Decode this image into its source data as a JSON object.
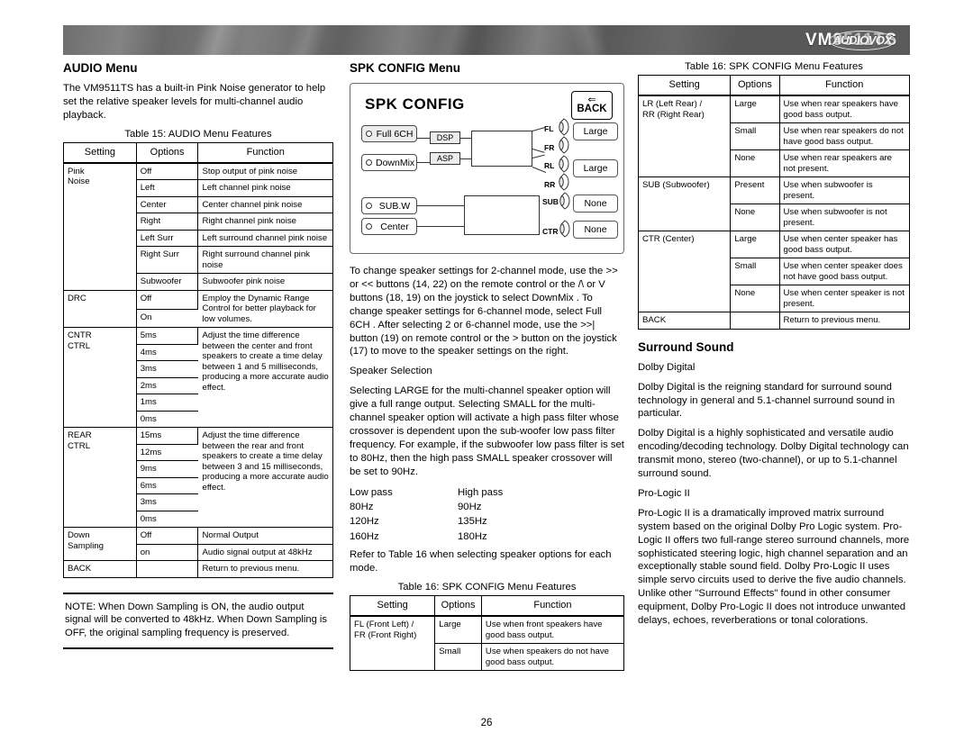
{
  "header": {
    "model": "VM9511TS",
    "logo": "AUDIOVOX"
  },
  "page_number": "26",
  "left_column": {
    "heading": "AUDIO Menu",
    "intro": "The VM9511TS has a built-in Pink Noise generator to help set the relative speaker levels for multi-channel audio playback.",
    "table_caption": "Table 15: AUDIO Menu Features",
    "table": {
      "headers": [
        "Setting",
        "Options",
        "Function"
      ],
      "groups": [
        {
          "setting": "Pink\nNoise",
          "rows": [
            {
              "option": "Off",
              "function": "Stop output of pink noise"
            },
            {
              "option": "Left",
              "function": "Left channel pink noise"
            },
            {
              "option": "Center",
              "function": "Center channel pink noise"
            },
            {
              "option": "Right",
              "function": "Right channel pink noise"
            },
            {
              "option": "Left Surr",
              "function": "Left surround channel pink noise"
            },
            {
              "option": "Right Surr",
              "function": "Right surround channel pink noise"
            },
            {
              "option": "Subwoofer",
              "function": "Subwoofer pink noise"
            }
          ]
        },
        {
          "setting": "DRC",
          "rows": [
            {
              "option": "Off",
              "function": "Employ the Dynamic Range Control for better playback for low volumes."
            },
            {
              "option": "On",
              "function": ""
            }
          ]
        },
        {
          "setting": "CNTR\nCTRL",
          "rows": [
            {
              "option": "5ms",
              "function": "Adjust the time difference between the center and front speakers to create a time delay between 1 and 5 milliseconds, producing a more accurate audio effect."
            },
            {
              "option": "4ms",
              "function": ""
            },
            {
              "option": "3ms",
              "function": ""
            },
            {
              "option": "2ms",
              "function": ""
            },
            {
              "option": "1ms",
              "function": ""
            },
            {
              "option": "0ms",
              "function": ""
            }
          ]
        },
        {
          "setting": "REAR\nCTRL",
          "rows": [
            {
              "option": "15ms",
              "function": "Adjust the time difference between the rear and front speakers to create a time delay between 3 and 15 milliseconds, producing a more accurate audio effect."
            },
            {
              "option": "12ms",
              "function": ""
            },
            {
              "option": "9ms",
              "function": ""
            },
            {
              "option": "6ms",
              "function": ""
            },
            {
              "option": "3ms",
              "function": ""
            },
            {
              "option": "0ms",
              "function": ""
            }
          ]
        },
        {
          "setting": "Down\nSampling",
          "rows": [
            {
              "option": "Off",
              "function": "Normal Output"
            },
            {
              "option": "on",
              "function": "Audio signal output at 48kHz"
            }
          ]
        },
        {
          "setting": "BACK",
          "rows": [
            {
              "option": "",
              "function": "Return to previous menu."
            }
          ]
        }
      ]
    },
    "note": "NOTE: When Down Sampling is ON, the audio output signal will be converted to 48kHz. When Down Sampling is OFF, the original sampling frequency is preserved."
  },
  "center_column": {
    "heading": "SPK CONFIG Menu",
    "screen": {
      "title": "SPK CONFIG",
      "back_label": "BACK",
      "back_arrow": "⇐",
      "modes": [
        {
          "label": "Full 6CH",
          "selected": true
        },
        {
          "label": "DownMix",
          "selected": false
        }
      ],
      "processors": [
        "DSP",
        "ASP"
      ],
      "sources": [
        {
          "label": "SUB.W"
        },
        {
          "label": "Center"
        }
      ],
      "speakers": [
        {
          "tag": "FL"
        },
        {
          "tag": "FR"
        },
        {
          "tag": "RL"
        },
        {
          "tag": "RR"
        },
        {
          "tag": "SUB"
        },
        {
          "tag": "CTR"
        }
      ],
      "sizes": [
        "Large",
        "Large",
        "None",
        "None"
      ]
    },
    "paragraph1": "To change speaker settings for 2-channel mode, use the >> or << buttons (14, 22) on the remote control or the /\\ or V buttons (18, 19) on the joystick to select  DownMix . To change speaker settings for 6-channel mode, select  Full 6CH . After selecting 2 or 6-channel mode, use the >>| button (19) on remote control or the > button on the joystick (17) to move to the speaker settings on the right.",
    "subheading": "Speaker Selection",
    "paragraph2": "Selecting LARGE for the multi-channel speaker option will give a full range output. Selecting SMALL for the multi-channel speaker option will activate a high pass filter whose crossover is dependent upon the sub-woofer low pass filter frequency. For example, if the subwoofer low pass filter is set to 80Hz, then the high pass SMALL speaker crossover will be set to 90Hz.",
    "pass_table": {
      "header_low": "Low pass",
      "header_high": "High pass",
      "rows": [
        {
          "low": "80Hz",
          "high": "90Hz"
        },
        {
          "low": "120Hz",
          "high": "135Hz"
        },
        {
          "low": "160Hz",
          "high": "180Hz"
        }
      ]
    },
    "paragraph3": "Refer to Table 16 when selecting speaker options for each mode.",
    "table_caption": "Table 16: SPK CONFIG Menu Features",
    "table": {
      "headers": [
        "Setting",
        "Options",
        "Function"
      ],
      "groups": [
        {
          "setting": "FL (Front Left) /\nFR (Front Right)",
          "rows": [
            {
              "option": "Large",
              "function": "Use when front speakers have good bass output."
            },
            {
              "option": "Small",
              "function": "Use when speakers do not have good bass output."
            }
          ]
        }
      ]
    }
  },
  "right_column": {
    "table_caption": "Table 16: SPK CONFIG Menu Features",
    "table": {
      "headers": [
        "Setting",
        "Options",
        "Function"
      ],
      "groups": [
        {
          "setting": "LR (Left Rear) /\nRR (Right Rear)",
          "rows": [
            {
              "option": "Large",
              "function": "Use when rear speakers have good bass output."
            },
            {
              "option": "Small",
              "function": "Use when rear speakers do not have good bass output."
            },
            {
              "option": "None",
              "function": "Use when rear speakers are not present."
            }
          ]
        },
        {
          "setting": "SUB (Subwoofer)",
          "rows": [
            {
              "option": "Present",
              "function": "Use when subwoofer is present."
            },
            {
              "option": "None",
              "function": "Use when subwoofer is not present."
            }
          ]
        },
        {
          "setting": "CTR (Center)",
          "rows": [
            {
              "option": "Large",
              "function": "Use when center speaker has good bass output."
            },
            {
              "option": "Small",
              "function": "Use when center speaker does not have good bass output."
            },
            {
              "option": "None",
              "function": "Use when center speaker is not present."
            }
          ]
        },
        {
          "setting": "BACK",
          "rows": [
            {
              "option": "",
              "function": "Return to previous menu."
            }
          ]
        }
      ]
    },
    "heading": "Surround Sound",
    "dolby_title": "Dolby Digital",
    "dolby_p1": "Dolby Digital is the reigning standard for surround sound technology in general and 5.1-channel surround sound in particular.",
    "dolby_p2": "Dolby Digital is a highly sophisticated and versatile audio encoding/decoding technology. Dolby Digital technology can transmit mono, stereo (two-channel), or up to 5.1-channel surround sound.",
    "prologic_title": "Pro-Logic II",
    "prologic_p1": "Pro-Logic II is a dramatically improved matrix surround system based on the original Dolby Pro Logic system. Pro-Logic II offers two full-range stereo surround channels, more sophisticated steering logic, high channel separation and an exceptionally stable sound field. Dolby Pro-Logic II uses simple servo circuits used to derive the five audio channels. Unlike other \"Surround Effects\" found in other consumer equipment, Dolby Pro-Logic II does not introduce unwanted delays, echoes, reverberations or tonal colorations."
  }
}
